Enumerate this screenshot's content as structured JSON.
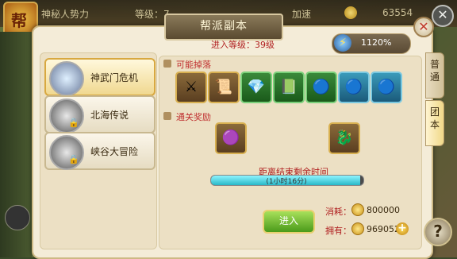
{
  "topbar": {
    "guild_name": "神秘人势力",
    "level_label": "等级：7",
    "button_label": "加速",
    "gold": "63554"
  },
  "dialog": {
    "title": "帮派副本",
    "entry_level": "进入等级：39级",
    "energy": "1120%"
  },
  "dungeons": [
    {
      "label": "神武门危机",
      "locked": false,
      "active": true
    },
    {
      "label": "北海传说",
      "locked": true,
      "active": false
    },
    {
      "label": "峡谷大冒险",
      "locked": true,
      "active": false
    }
  ],
  "drops": {
    "title": "可能掉落",
    "items": [
      "weapon-icon",
      "scroll-icon",
      "green-gem-icon",
      "book-icon",
      "blue-orbs-icon",
      "blue-orbs-icon",
      "blue-orbs-icon"
    ]
  },
  "rewards": {
    "title": "通关奖励",
    "items": [
      "purple-token-icon",
      "orange-dragon-icon"
    ]
  },
  "timer": {
    "title": "距离结束剩余时间",
    "text": "(1小时16分)",
    "progress": 0.98
  },
  "actions": {
    "enter_label": "进入",
    "cost_label": "消耗：",
    "cost_value": "800000",
    "own_label": "拥有：",
    "own_value": "9690525"
  },
  "tabs": [
    {
      "label": "普通",
      "active": false
    },
    {
      "label": "团本",
      "active": true
    }
  ],
  "colors": {
    "accent": "#b02020",
    "progress": "#28b8c8",
    "gold": "#c89018"
  }
}
